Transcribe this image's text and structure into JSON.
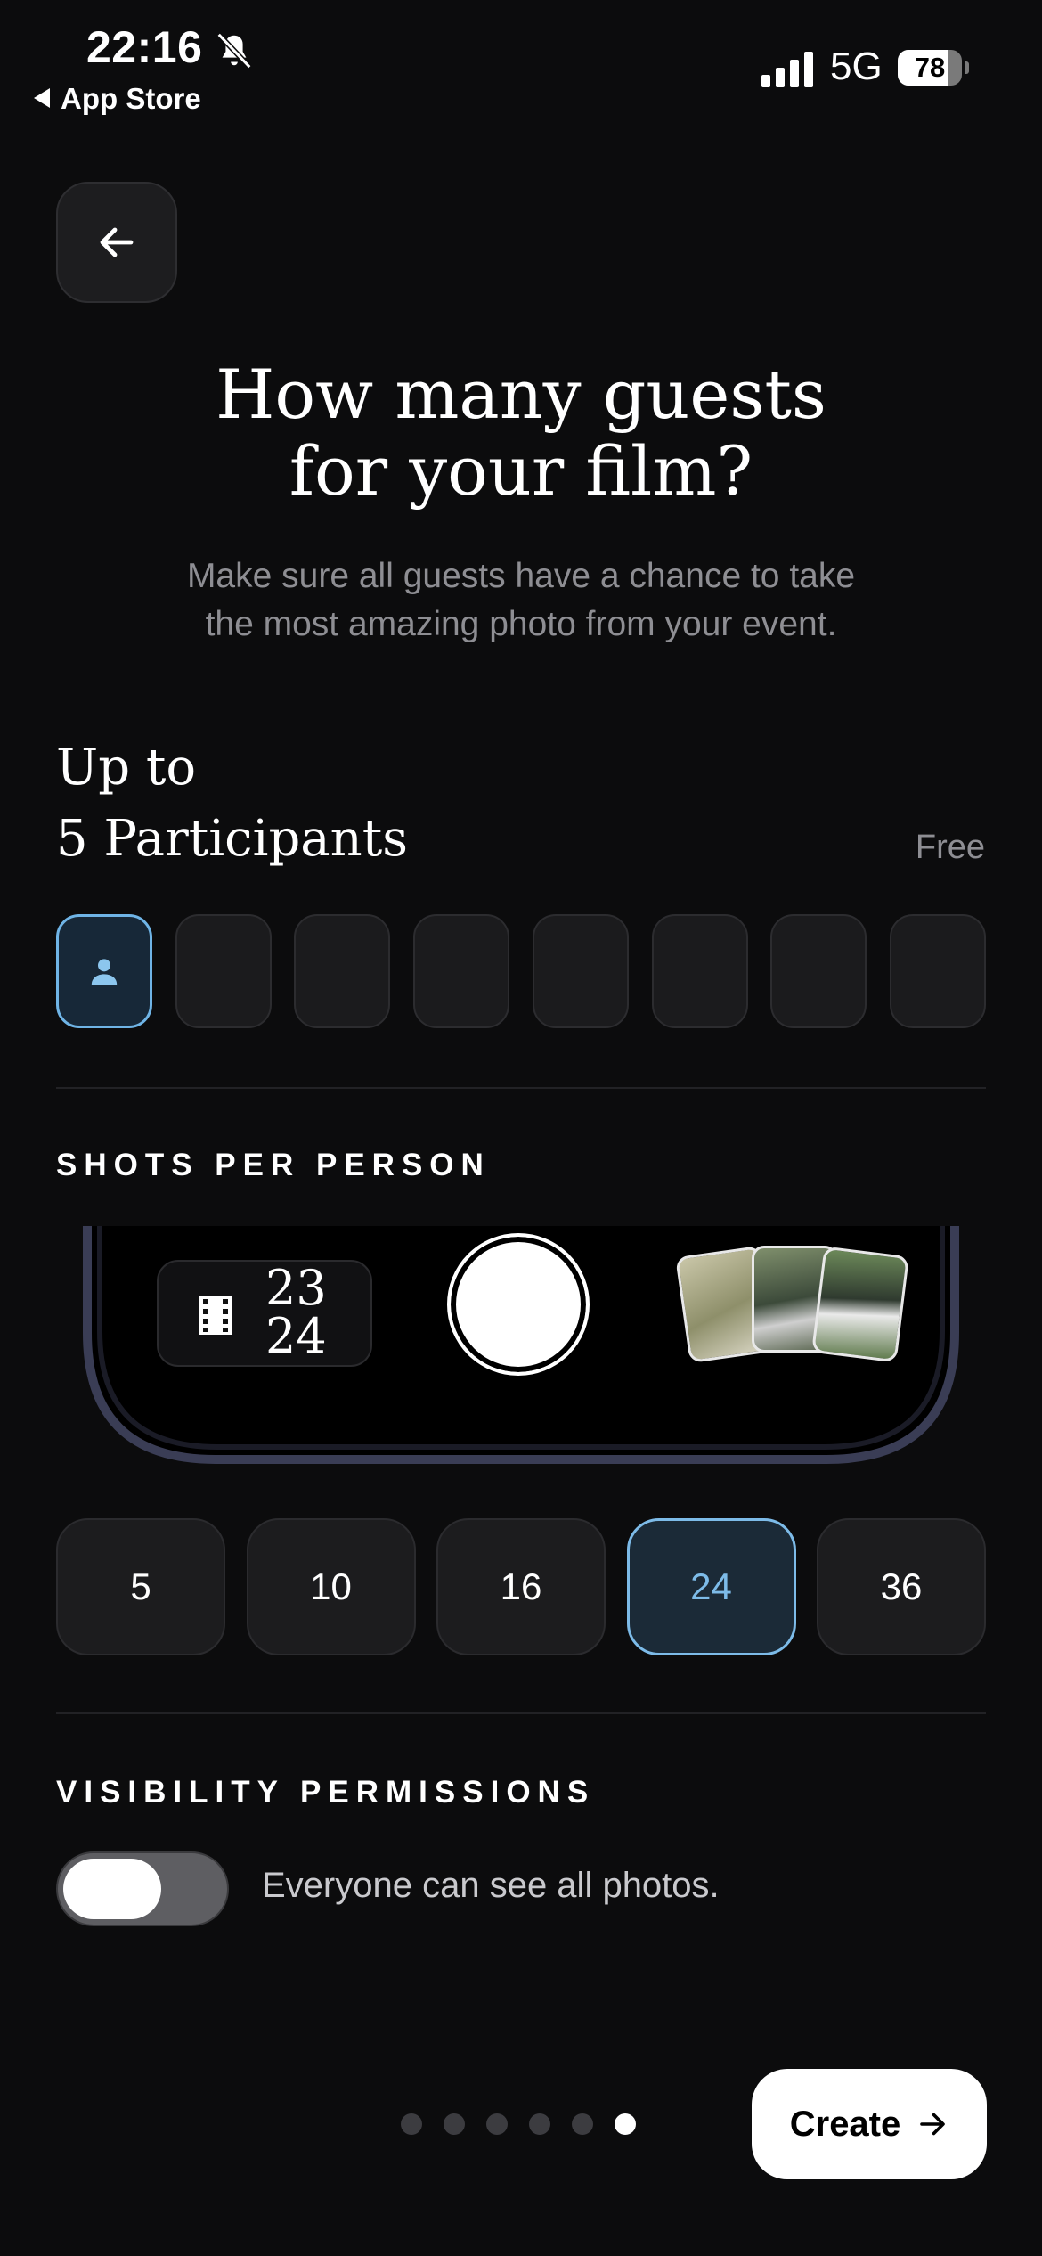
{
  "status_bar": {
    "time": "22:16",
    "back_app": "App Store",
    "network": "5G",
    "battery": "78",
    "battery_level": 0.78
  },
  "header": {
    "title_line1": "How many guests",
    "title_line2": "for your film?",
    "subtitle_line1": "Make sure all guests have a chance to take",
    "subtitle_line2": "the most amazing photo from your event."
  },
  "participants": {
    "line1": "Up to",
    "line2": "5 Participants",
    "price": "Free"
  },
  "shots_per_person": {
    "label": "SHOTS PER PERSON",
    "counter_top": "23",
    "counter_bottom": "24",
    "options": [
      "5",
      "10",
      "16",
      "24",
      "36"
    ],
    "selected": "24"
  },
  "visibility": {
    "label": "VISIBILITY PERMISSIONS",
    "toggle_text": "Everyone can see all photos."
  },
  "footer": {
    "create_label": "Create",
    "page_count": 6,
    "current_page": 6
  },
  "colors": {
    "background": "#0c0c0d",
    "accent": "#7dbbe8"
  },
  "icons": [
    "bell-slash-icon",
    "signal-icon",
    "battery-icon",
    "arrow-left-icon",
    "person-icon",
    "film-icon",
    "arrow-right-icon"
  ]
}
